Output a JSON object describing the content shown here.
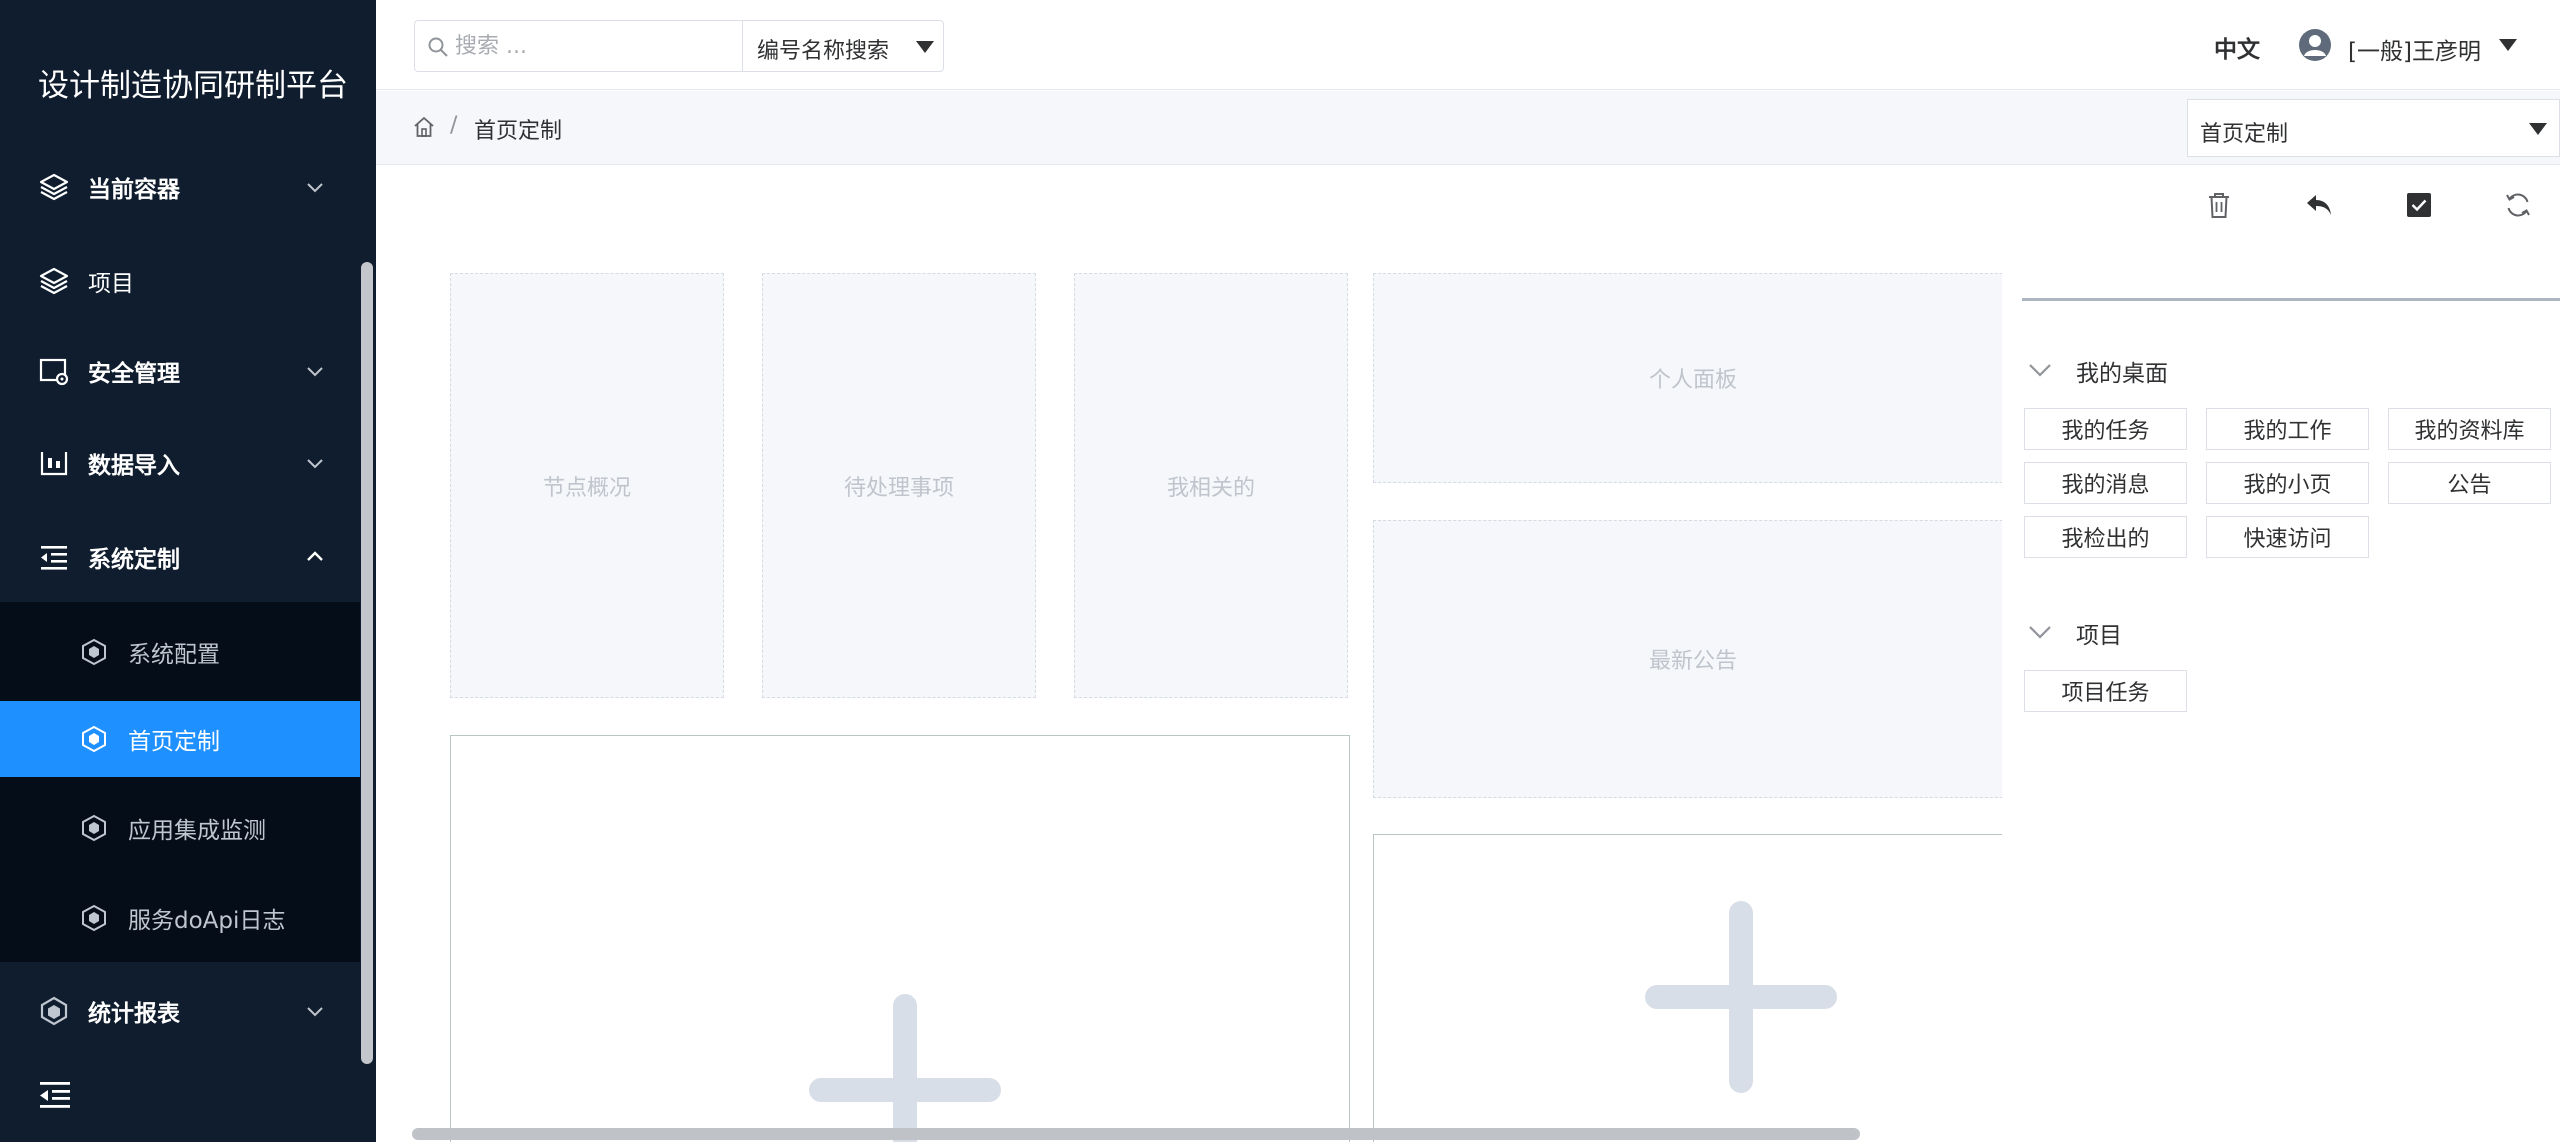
{
  "app": {
    "title": "设计制造协同研制平台"
  },
  "sidebar": {
    "items": [
      {
        "label": "当前容器",
        "icon": "layers-icon",
        "expanded": false
      },
      {
        "label": "项目",
        "icon": "layers-icon"
      },
      {
        "label": "安全管理",
        "icon": "security-settings-icon",
        "expanded": false
      },
      {
        "label": "数据导入",
        "icon": "data-import-icon",
        "expanded": false
      },
      {
        "label": "系统定制",
        "icon": "indent-list-icon",
        "expanded": true
      },
      {
        "label": "统计报表",
        "icon": "hexagon-icon",
        "expanded": false
      }
    ],
    "submenu": [
      {
        "label": "系统配置",
        "icon": "hexagon-icon"
      },
      {
        "label": "首页定制",
        "icon": "hexagon-icon",
        "active": true
      },
      {
        "label": "应用集成监测",
        "icon": "hexagon-icon"
      },
      {
        "label": "服务doApi日志",
        "icon": "hexagon-icon"
      }
    ],
    "colors": {
      "background": "#0f1d2e",
      "submenu_background": "#050d18",
      "active": "#1e90ff"
    }
  },
  "header": {
    "search": {
      "placeholder": "搜索 ...",
      "value": "",
      "mode": "编号名称搜索"
    },
    "language": "中文",
    "user": "[一般]王彦明"
  },
  "breadcrumb": {
    "current": "首页定制",
    "separator": "/"
  },
  "page_select": {
    "value": "首页定制"
  },
  "toolbar": {
    "icons": [
      "trash-icon",
      "undo-icon",
      "save-check-icon",
      "refresh-icon"
    ]
  },
  "canvas": {
    "widgets": [
      "节点概况",
      "待处理事项",
      "我相关的",
      "个人面板",
      "最新公告"
    ]
  },
  "panel": {
    "groups": [
      {
        "title": "我的桌面",
        "chips": [
          "我的任务",
          "我的工作",
          "我的资料库",
          "我的消息",
          "我的小页",
          "公告",
          "我检出的",
          "快速访问"
        ]
      },
      {
        "title": "项目",
        "chips": [
          "项目任务"
        ]
      }
    ]
  }
}
